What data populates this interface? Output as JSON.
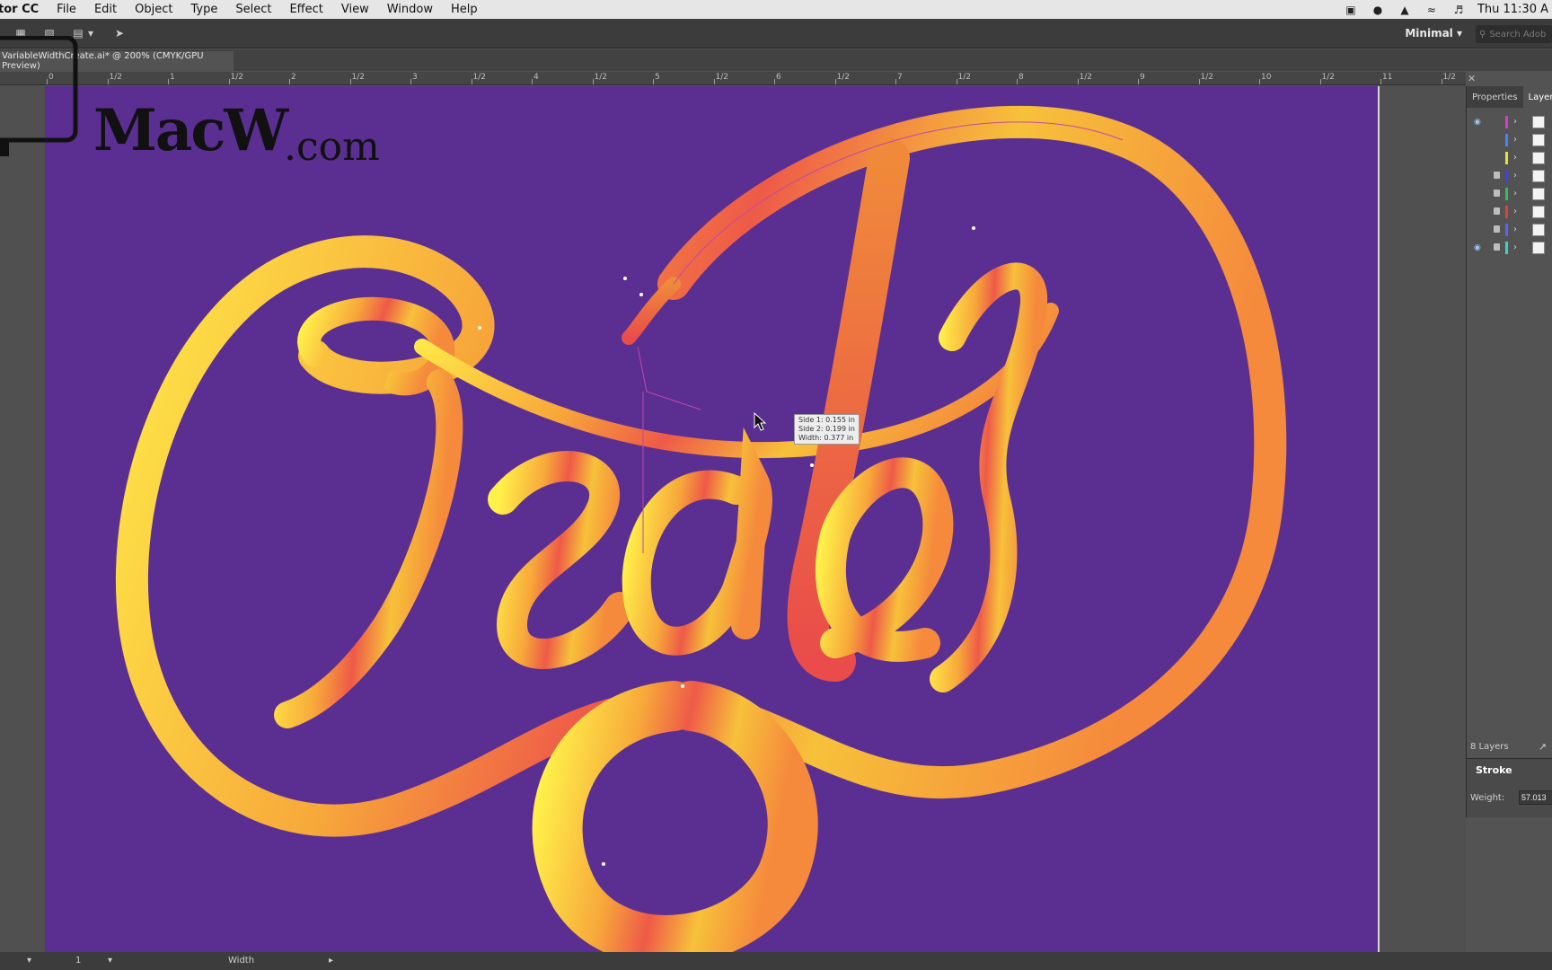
{
  "menubar": {
    "app_name": "tor CC",
    "items": [
      "File",
      "Edit",
      "Object",
      "Type",
      "Select",
      "Effect",
      "View",
      "Window",
      "Help"
    ],
    "clock": "Thu 11:30 A"
  },
  "controlbar": {
    "workspace": "Minimal",
    "search_placeholder": "Search Adob"
  },
  "document": {
    "tab_title": "VariableWidthCreate.ai* @ 200% (CMYK/GPU Preview)"
  },
  "ruler": {
    "labels": [
      "0",
      "1/2",
      "1",
      "1/2",
      "2",
      "1/2",
      "3",
      "1/2",
      "4",
      "1/2",
      "5",
      "1/2",
      "6",
      "1/2",
      "7",
      "1/2",
      "8",
      "1/2",
      "9",
      "1/2",
      "10",
      "1/2",
      "11",
      "1/2"
    ]
  },
  "canvas": {
    "artboard_color": "#5a2f91",
    "artwork_text": "Create",
    "tooltip": {
      "line1": "Side 1: 0.155 in",
      "line2": "Side 2: 0.199 in",
      "line3": "Width: 0.377 in"
    }
  },
  "watermark": {
    "brand": "MacW",
    "domain": ".com"
  },
  "right_panel": {
    "tabs": [
      "Properties",
      "Layers"
    ],
    "layers": [
      {
        "visible": true,
        "locked": false,
        "color": "#d040d0"
      },
      {
        "visible": false,
        "locked": false,
        "color": "#4a80ff"
      },
      {
        "visible": false,
        "locked": false,
        "color": "#e0e040"
      },
      {
        "visible": false,
        "locked": true,
        "color": "#4040ff"
      },
      {
        "visible": false,
        "locked": true,
        "color": "#30c060"
      },
      {
        "visible": false,
        "locked": true,
        "color": "#e04040"
      },
      {
        "visible": false,
        "locked": true,
        "color": "#6060ff"
      },
      {
        "visible": true,
        "locked": true,
        "color": "#40d0c0"
      }
    ],
    "layers_count": "8 Layers",
    "stroke_title": "Stroke",
    "weight_label": "Weight:",
    "weight_value": "57.013"
  },
  "statusbar": {
    "zoom": "1",
    "tool": "Width"
  }
}
